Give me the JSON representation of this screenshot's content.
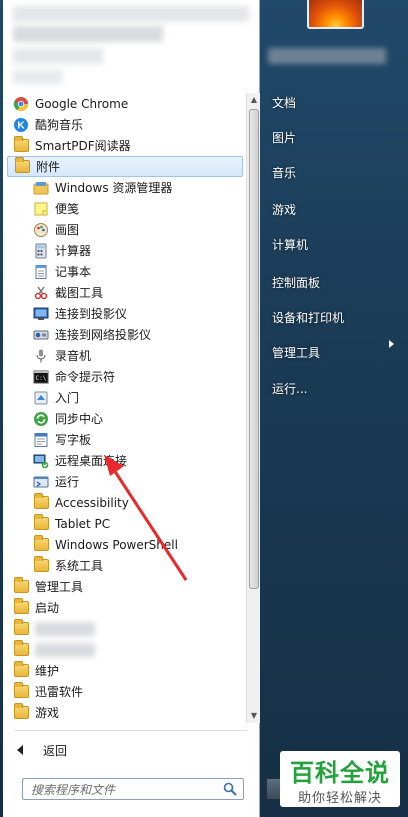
{
  "left_panel": {
    "programs": [
      {
        "label": "Google Chrome",
        "icon": "chrome-icon",
        "level": 0,
        "type": "app"
      },
      {
        "label": "酷狗音乐",
        "icon": "kugou-icon",
        "level": 0,
        "type": "app"
      },
      {
        "label": "SmartPDF阅读器",
        "icon": "folder-icon",
        "level": 0,
        "type": "folder"
      },
      {
        "label": "附件",
        "icon": "folder-icon",
        "level": 0,
        "type": "folder",
        "selected": true
      },
      {
        "label": "Windows 资源管理器",
        "icon": "explorer-icon",
        "level": 1,
        "type": "app"
      },
      {
        "label": "便笺",
        "icon": "sticky-notes-icon",
        "level": 1,
        "type": "app"
      },
      {
        "label": "画图",
        "icon": "paint-icon",
        "level": 1,
        "type": "app"
      },
      {
        "label": "计算器",
        "icon": "calculator-icon",
        "level": 1,
        "type": "app"
      },
      {
        "label": "记事本",
        "icon": "notepad-icon",
        "level": 1,
        "type": "app"
      },
      {
        "label": "截图工具",
        "icon": "snipping-tool-icon",
        "level": 1,
        "type": "app"
      },
      {
        "label": "连接到投影仪",
        "icon": "projector-icon",
        "level": 1,
        "type": "app"
      },
      {
        "label": "连接到网络投影仪",
        "icon": "network-projector-icon",
        "level": 1,
        "type": "app"
      },
      {
        "label": "录音机",
        "icon": "microphone-icon",
        "level": 1,
        "type": "app"
      },
      {
        "label": "命令提示符",
        "icon": "cmd-icon",
        "level": 1,
        "type": "app"
      },
      {
        "label": "入门",
        "icon": "getting-started-icon",
        "level": 1,
        "type": "app"
      },
      {
        "label": "同步中心",
        "icon": "sync-center-icon",
        "level": 1,
        "type": "app"
      },
      {
        "label": "写字板",
        "icon": "wordpad-icon",
        "level": 1,
        "type": "app"
      },
      {
        "label": "远程桌面连接",
        "icon": "remote-desktop-icon",
        "level": 1,
        "type": "app"
      },
      {
        "label": "运行",
        "icon": "run-icon",
        "level": 1,
        "type": "app"
      },
      {
        "label": "Accessibility",
        "icon": "folder-icon",
        "level": 1,
        "type": "folder"
      },
      {
        "label": "Tablet PC",
        "icon": "folder-icon",
        "level": 1,
        "type": "folder"
      },
      {
        "label": "Windows PowerShell",
        "icon": "folder-icon",
        "level": 1,
        "type": "folder"
      },
      {
        "label": "系统工具",
        "icon": "folder-icon",
        "level": 1,
        "type": "folder"
      },
      {
        "label": "管理工具",
        "icon": "folder-icon",
        "level": 0,
        "type": "folder"
      },
      {
        "label": "启动",
        "icon": "folder-icon",
        "level": 0,
        "type": "folder"
      },
      {
        "label": "",
        "icon": "folder-icon",
        "level": 0,
        "type": "folder",
        "blurred": true
      },
      {
        "label": "",
        "icon": "folder-icon",
        "level": 0,
        "type": "folder",
        "blurred": true
      },
      {
        "label": "维护",
        "icon": "folder-icon",
        "level": 0,
        "type": "folder"
      },
      {
        "label": "迅雷软件",
        "icon": "folder-icon",
        "level": 0,
        "type": "folder"
      },
      {
        "label": "游戏",
        "icon": "folder-icon",
        "level": 0,
        "type": "folder"
      }
    ],
    "back_label": "返回",
    "search_placeholder": "搜索程序和文件"
  },
  "right_panel": {
    "items": [
      {
        "label": "文档"
      },
      {
        "label": "图片"
      },
      {
        "label": "音乐"
      },
      {
        "label": "游戏"
      },
      {
        "label": "计算机"
      },
      {
        "label": "控制面板"
      },
      {
        "label": "设备和打印机"
      },
      {
        "label": "管理工具",
        "has_submenu": true
      },
      {
        "label": "运行..."
      }
    ]
  },
  "watermark": {
    "title": "百科全说",
    "subtitle": "助你轻松解决"
  },
  "colors": {
    "accent_selection": "#d5e7fa",
    "annotation_red": "#e8282a",
    "watermark_green": "#23a23c"
  }
}
